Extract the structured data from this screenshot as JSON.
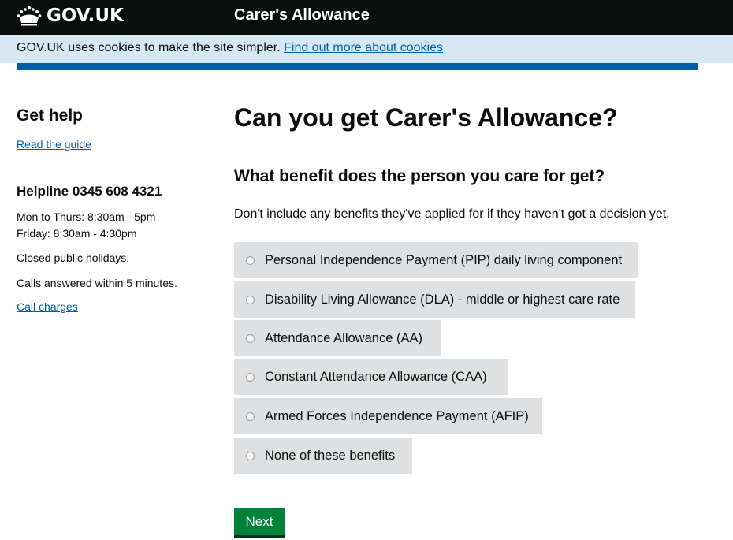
{
  "header": {
    "logo_text": "GOV.UK",
    "service_name": "Carer's Allowance"
  },
  "cookie_banner": {
    "text": "GOV.UK uses cookies to make the site simpler. ",
    "link": "Find out more about cookies"
  },
  "sidebar": {
    "get_help_heading": "Get help",
    "read_guide_link": "Read the guide",
    "helpline": "Helpline 0345 608 4321",
    "hours_weekday": "Mon to Thurs: 8:30am - 5pm",
    "hours_friday": "Friday: 8:30am - 4:30pm",
    "closed": "Closed public holidays.",
    "answered": "Calls answered within 5 minutes.",
    "call_charges_link": "Call charges"
  },
  "main": {
    "title": "Can you get Carer's Allowance?",
    "question": "What benefit does the person you care for get?",
    "hint": "Don't include any benefits they've applied for if they haven't got a decision yet.",
    "options": [
      "Personal Independence Payment (PIP) daily living component",
      "Disability Living Allowance (DLA) - middle or highest care rate",
      "Attendance Allowance (AA)",
      "Constant Attendance Allowance (CAA)",
      "Armed Forces Independence Payment (AFIP)",
      "None of these benefits"
    ],
    "next_button": "Next"
  },
  "colors": {
    "header_bg": "#0b0c0c",
    "cookie_bg": "#d5e8f3",
    "link": "#005ea5",
    "option_bg": "#dee0e2",
    "button_green": "#00823b"
  }
}
